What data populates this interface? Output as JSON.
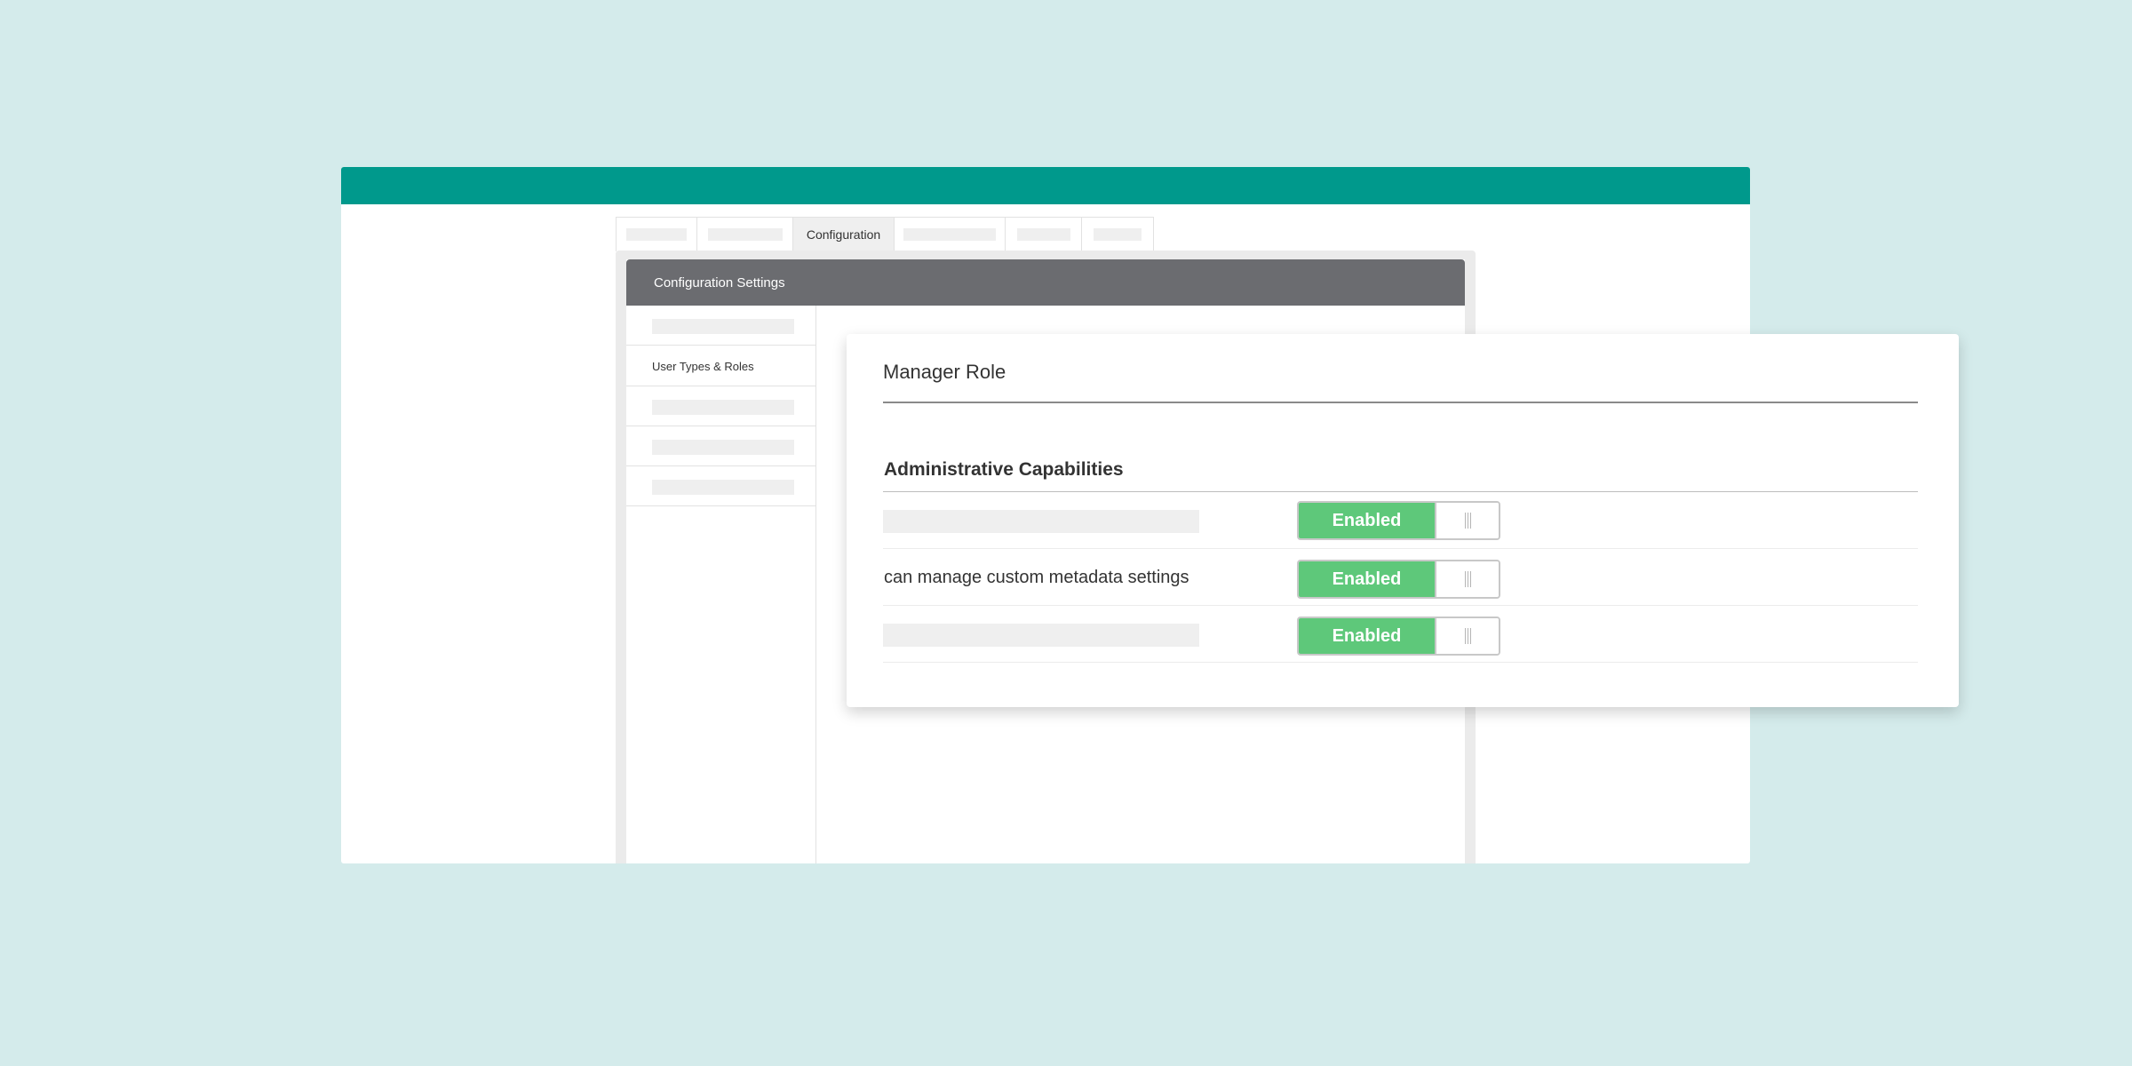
{
  "tabs": {
    "items": [
      {
        "label": "",
        "placeholder": true
      },
      {
        "label": "",
        "placeholder": true
      },
      {
        "label": "Configuration",
        "placeholder": false,
        "active": true
      },
      {
        "label": "",
        "placeholder": true
      },
      {
        "label": "",
        "placeholder": true
      },
      {
        "label": "",
        "placeholder": true
      }
    ]
  },
  "config": {
    "header_title": "Configuration Settings",
    "side_nav": {
      "items": [
        {
          "label": "",
          "placeholder": true
        },
        {
          "label": "User Types & Roles",
          "placeholder": false,
          "active": true
        },
        {
          "label": "",
          "placeholder": true
        },
        {
          "label": "",
          "placeholder": true
        },
        {
          "label": "",
          "placeholder": true
        }
      ]
    }
  },
  "role_card": {
    "title": "Manager Role",
    "section_title": "Administrative Capabilities",
    "capabilities": [
      {
        "label": "",
        "placeholder": true,
        "toggle_label": "Enabled",
        "enabled": true
      },
      {
        "label": "can manage custom metadata settings",
        "placeholder": false,
        "toggle_label": "Enabled",
        "enabled": true
      },
      {
        "label": "",
        "placeholder": true,
        "toggle_label": "Enabled",
        "enabled": true
      }
    ]
  },
  "colors": {
    "topbar": "#00998c",
    "background": "#d4ebeb",
    "header": "#6b6c70",
    "enabled": "#5ec87a"
  }
}
